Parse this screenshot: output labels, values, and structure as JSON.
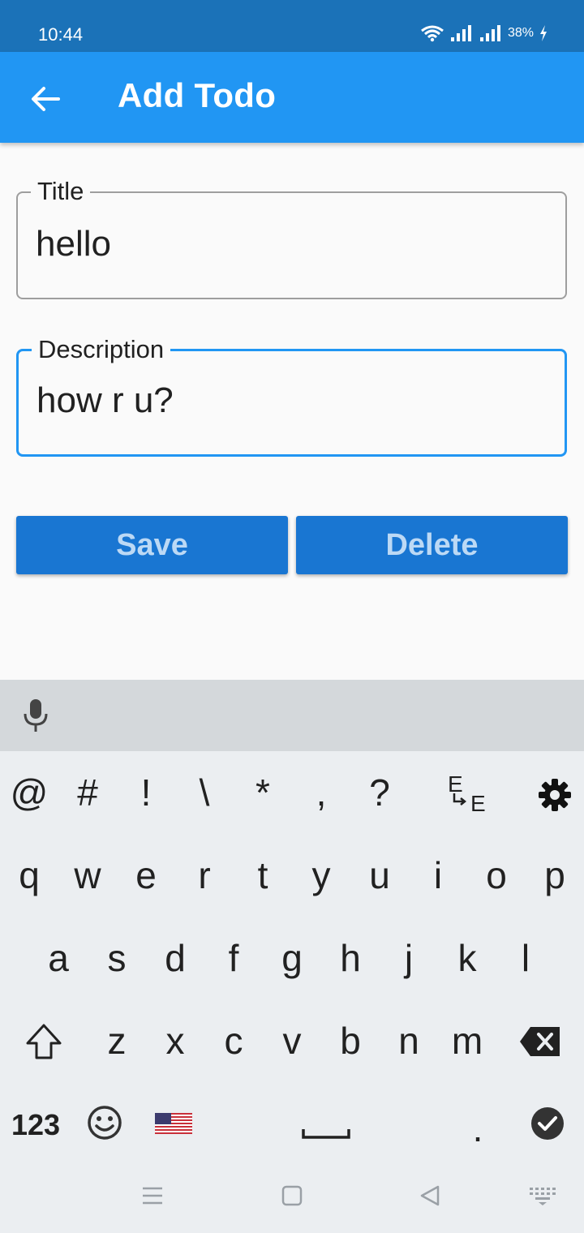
{
  "status_bar": {
    "time": "10:44",
    "battery": "38%"
  },
  "app_bar": {
    "title": "Add Todo"
  },
  "form": {
    "title_label": "Title",
    "title_value": "hello",
    "description_label": "Description",
    "description_value": "how r u?"
  },
  "actions": {
    "save_label": "Save",
    "delete_label": "Delete"
  },
  "keyboard": {
    "symbols": [
      "@",
      "#",
      "!",
      "\\",
      "*",
      ",",
      "?"
    ],
    "row1": [
      "q",
      "w",
      "e",
      "r",
      "t",
      "y",
      "u",
      "i",
      "o",
      "p"
    ],
    "row2": [
      "a",
      "s",
      "d",
      "f",
      "g",
      "h",
      "j",
      "k",
      "l"
    ],
    "row3": [
      "z",
      "x",
      "c",
      "v",
      "b",
      "n",
      "m"
    ],
    "numbers_label": "123",
    "period": "."
  },
  "colors": {
    "app_bar": "#2196f3",
    "status_bar": "#1b72b8",
    "button": "#1976d2",
    "focus": "#2196f3"
  }
}
